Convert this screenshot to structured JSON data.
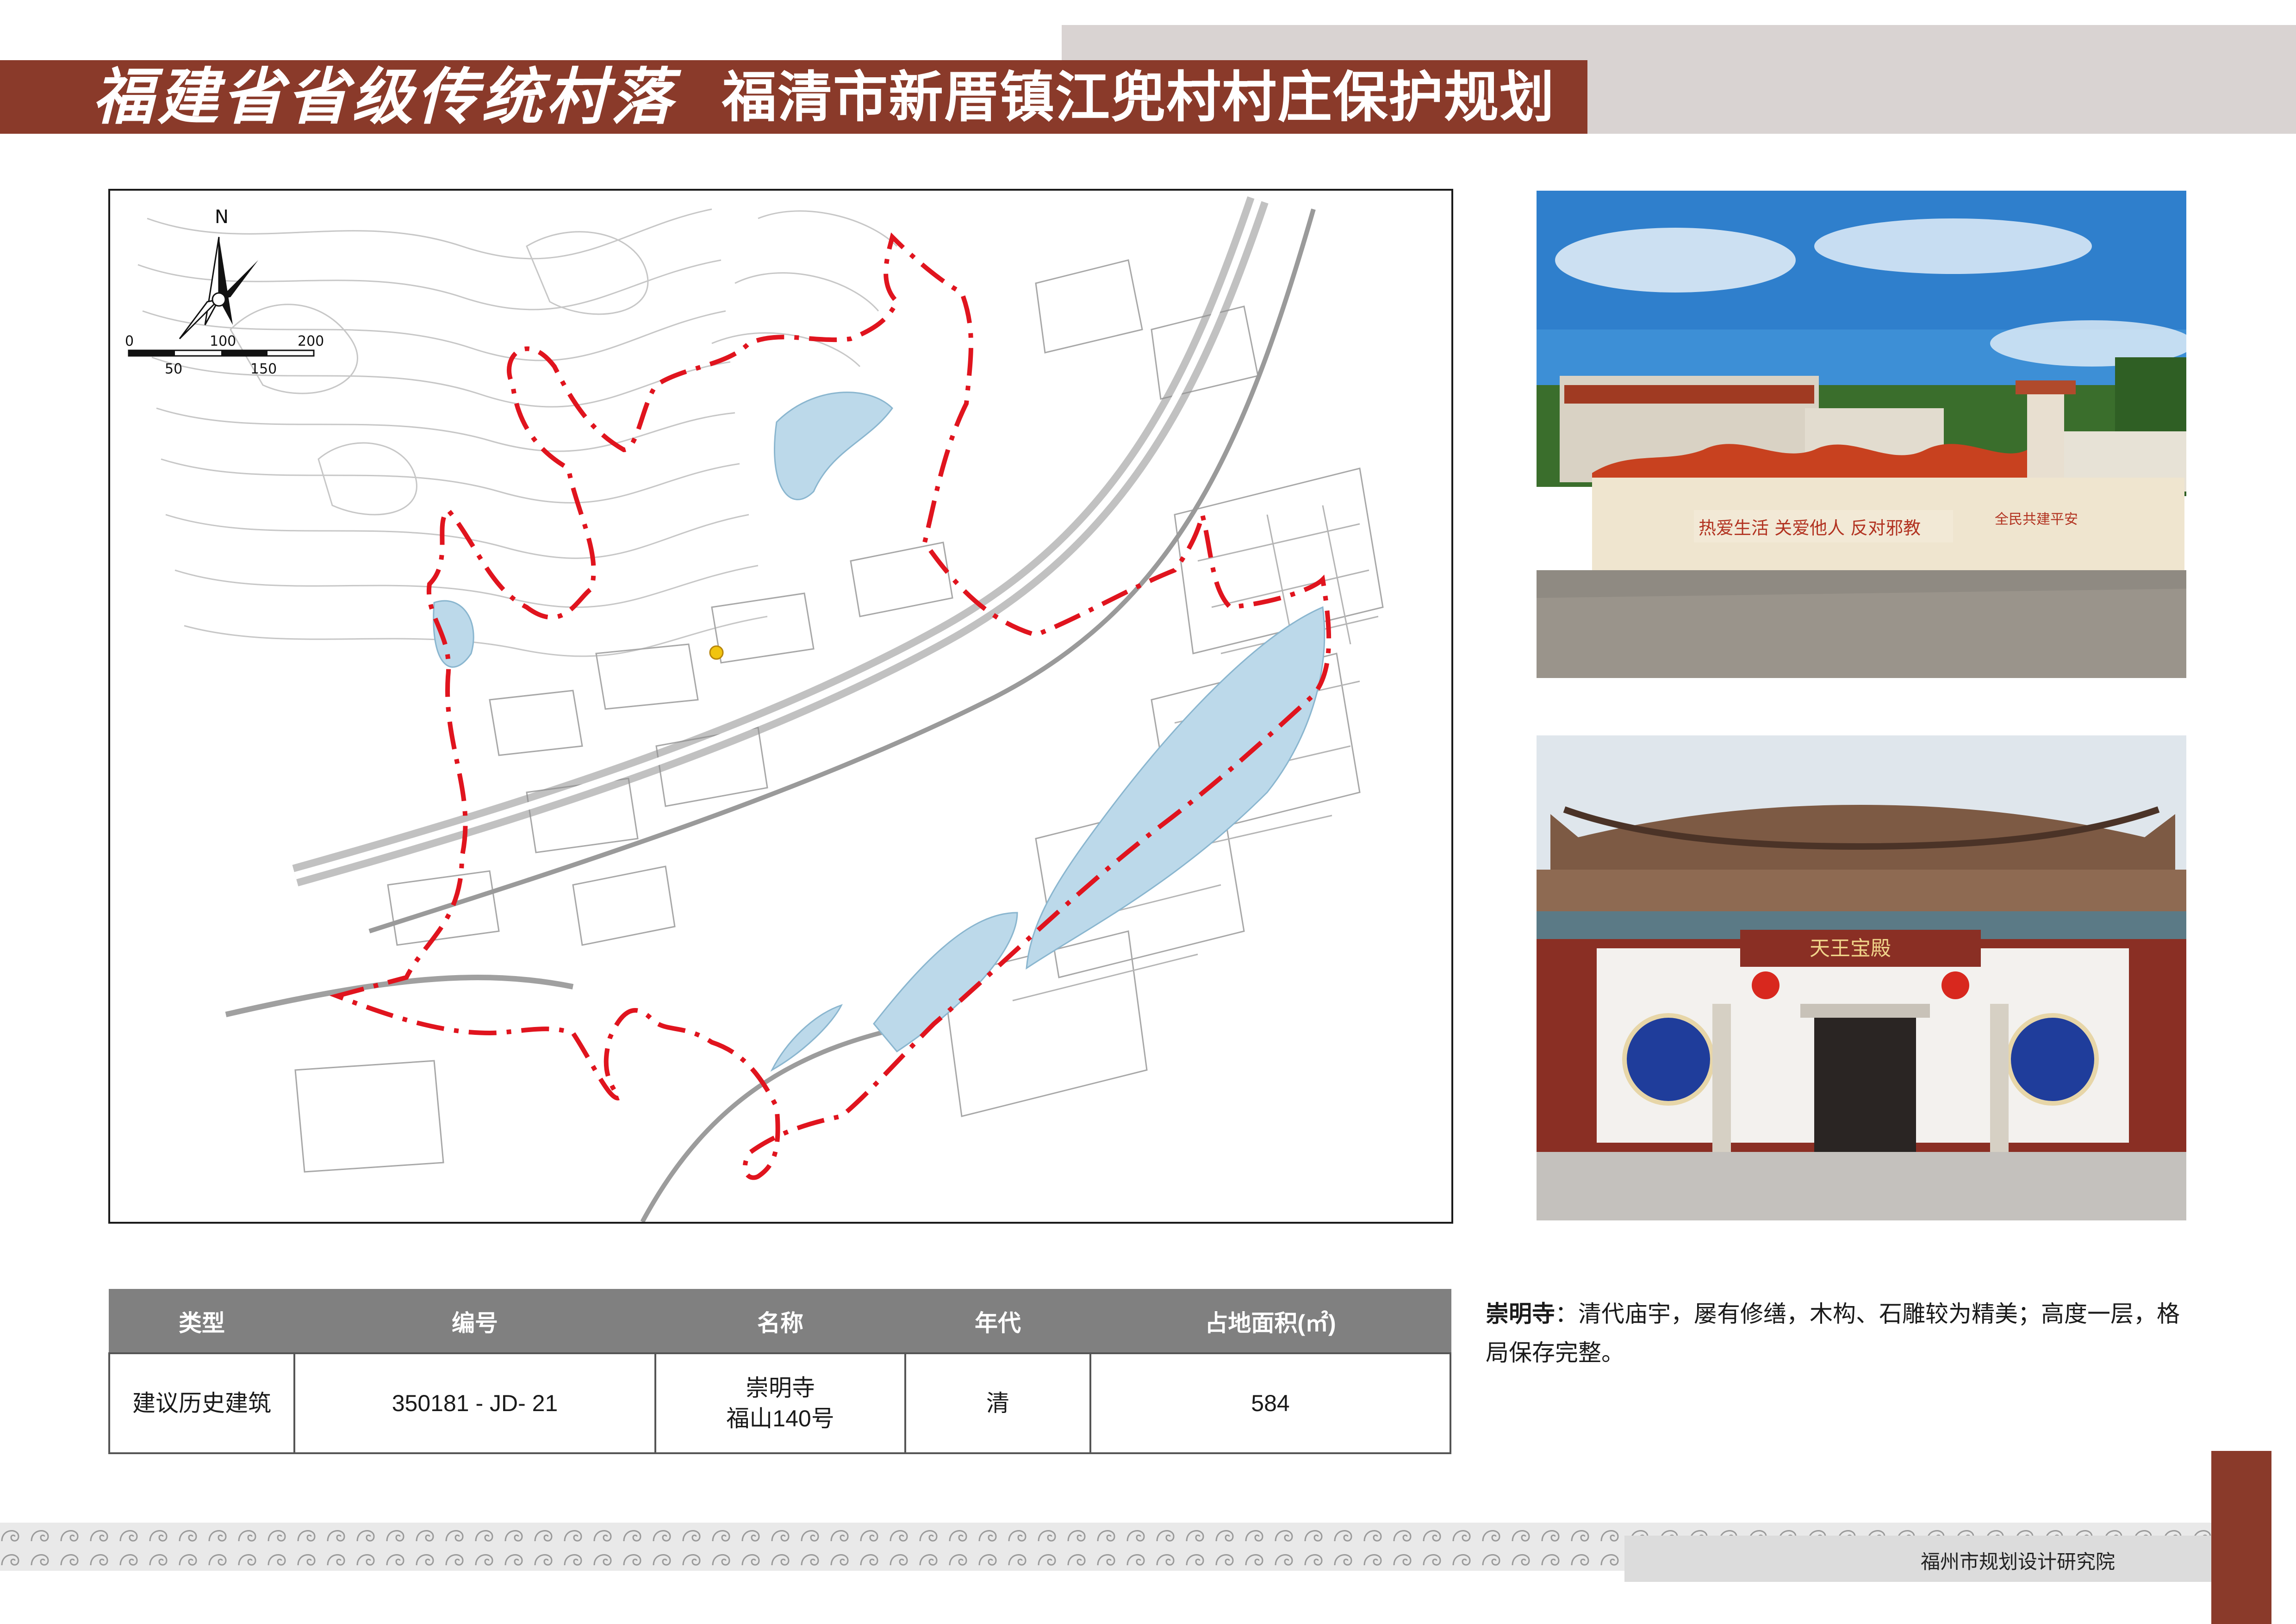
{
  "header": {
    "series_title": "福建省省级传统村落",
    "plan_title": "福清市新厝镇江兜村村庄保护规划"
  },
  "map": {
    "north_label": "N",
    "scale_top": [
      "0",
      "100",
      "200"
    ],
    "scale_bottom": [
      "50",
      "150"
    ]
  },
  "table": {
    "headers": [
      "类型",
      "编号",
      "名称",
      "年代",
      "占地面积(㎡)"
    ],
    "row": {
      "type": "建议历史建筑",
      "code": "350181 - JD- 21",
      "name_line1": "崇明寺",
      "name_line2": "福山140号",
      "era": "清",
      "area": "584"
    }
  },
  "description": {
    "label": "崇明寺",
    "text": "：清代庙宇，屡有修缮，木构、石雕较为精美；高度一层，格局保存完整。"
  },
  "photos": {
    "top_signs": [
      "热爱生活 关爱他人 反对邪教",
      "全民共建平安"
    ],
    "bottom_plaque": "天王宝殿"
  },
  "footer": {
    "org": "福州市规划设计研究院"
  },
  "colors": {
    "brand_red": "#8a3a2a",
    "header_grey": "#d9d3d2",
    "boundary_red": "#e0141e",
    "water_blue": "#bcd9ea"
  }
}
